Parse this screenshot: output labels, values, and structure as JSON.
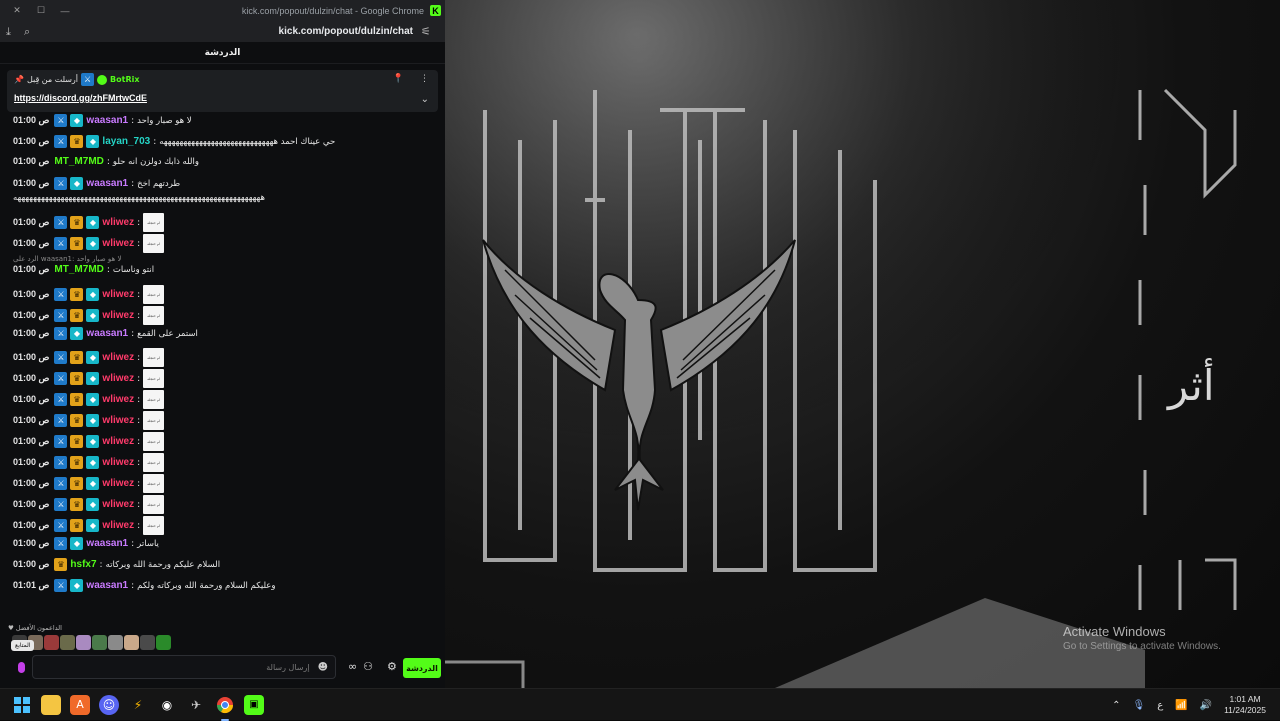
{
  "browser": {
    "window_title": "kick.com/popout/dulzin/chat - Google Chrome",
    "url": "kick.com/popout/dulzin/chat",
    "window_controls": [
      "✕",
      "☐",
      "—"
    ]
  },
  "chat": {
    "header_title": "الدردشة",
    "pinned": {
      "sent_by_label": "أرسلت من قِبل",
      "sender": "BotRix",
      "link": "https://discord.gg/zhFMrtwCdE"
    },
    "reply_hint": "الرد على waasan1: لا هو صبار واحد",
    "emote_label": "ام حنجله",
    "messages": [
      {
        "time": "01:00 ص",
        "user": "waasan1",
        "color": "#c97bff",
        "badges": [
          "blue",
          "cyan"
        ],
        "text": "لا هو صبار واحد"
      },
      {
        "time": "01:00 ص",
        "user": "layan_703",
        "color": "#25d4c6",
        "badges": [
          "blue",
          "gold",
          "cyan"
        ],
        "text": "حي عيناك احمد هههههههههههههههههههههههههههههه"
      },
      {
        "time": "01:00 ص",
        "user": "MT_M7MD",
        "color": "#53fc18",
        "badges": [],
        "text": "والله ذابك دولزن انه حلو"
      },
      {
        "time": "01:00 ص",
        "user": "waasan1",
        "color": "#c97bff",
        "badges": [
          "blue",
          "cyan"
        ],
        "text": "طردتهم اخخ"
      },
      {
        "time": "",
        "user": "",
        "color": "#eaeaea",
        "badges": [],
        "text": "هههههههههههههههههههههههههههههههههههههههههههههههههههههههههههههههه"
      },
      {
        "time": "01:00 ص",
        "user": "wliwez",
        "color": "#ff3b6b",
        "badges": [
          "blue",
          "gold",
          "cyan"
        ],
        "emote": true
      },
      {
        "time": "01:00 ص",
        "user": "wliwez",
        "color": "#ff3b6b",
        "badges": [
          "blue",
          "gold",
          "cyan"
        ],
        "emote": true
      },
      {
        "time": "01:00 ص",
        "user": "MT_M7MD",
        "color": "#53fc18",
        "badges": [],
        "text": "انتو وناسات"
      },
      {
        "time": "01:00 ص",
        "user": "wliwez",
        "color": "#ff3b6b",
        "badges": [
          "blue",
          "gold",
          "cyan"
        ],
        "emote": true
      },
      {
        "time": "01:00 ص",
        "user": "wliwez",
        "color": "#ff3b6b",
        "badges": [
          "blue",
          "gold",
          "cyan"
        ],
        "emote": true
      },
      {
        "time": "01:00 ص",
        "user": "waasan1",
        "color": "#c97bff",
        "badges": [
          "blue",
          "cyan"
        ],
        "text": "استمر على القمع"
      },
      {
        "time": "01:00 ص",
        "user": "wliwez",
        "color": "#ff3b6b",
        "badges": [
          "blue",
          "gold",
          "cyan"
        ],
        "emote": true
      },
      {
        "time": "01:00 ص",
        "user": "wliwez",
        "color": "#ff3b6b",
        "badges": [
          "blue",
          "gold",
          "cyan"
        ],
        "emote": true
      },
      {
        "time": "01:00 ص",
        "user": "wliwez",
        "color": "#ff3b6b",
        "badges": [
          "blue",
          "gold",
          "cyan"
        ],
        "emote": true
      },
      {
        "time": "01:00 ص",
        "user": "wliwez",
        "color": "#ff3b6b",
        "badges": [
          "blue",
          "gold",
          "cyan"
        ],
        "emote": true
      },
      {
        "time": "01:00 ص",
        "user": "wliwez",
        "color": "#ff3b6b",
        "badges": [
          "blue",
          "gold",
          "cyan"
        ],
        "emote": true
      },
      {
        "time": "01:00 ص",
        "user": "wliwez",
        "color": "#ff3b6b",
        "badges": [
          "blue",
          "gold",
          "cyan"
        ],
        "emote": true
      },
      {
        "time": "01:00 ص",
        "user": "wliwez",
        "color": "#ff3b6b",
        "badges": [
          "blue",
          "gold",
          "cyan"
        ],
        "emote": true
      },
      {
        "time": "01:00 ص",
        "user": "wliwez",
        "color": "#ff3b6b",
        "badges": [
          "blue",
          "gold",
          "cyan"
        ],
        "emote": true
      },
      {
        "time": "01:00 ص",
        "user": "wliwez",
        "color": "#ff3b6b",
        "badges": [
          "blue",
          "gold",
          "cyan"
        ],
        "emote": true
      },
      {
        "time": "01:00 ص",
        "user": "waasan1",
        "color": "#c97bff",
        "badges": [
          "blue",
          "cyan"
        ],
        "text": "ياساتر"
      },
      {
        "time": "01:00 ص",
        "user": "hsfx7",
        "color": "#53fc18",
        "badges": [
          "gold"
        ],
        "text": "السلام عليكم ورحمة الله وبركاته"
      },
      {
        "time": "01:01 ص",
        "user": "waasan1",
        "color": "#c97bff",
        "badges": [
          "blue",
          "cyan"
        ],
        "text": "وعليكم السلام ورحمة الله وبركاته ولكم"
      }
    ],
    "supporters_label": "الداعمون الأفضل",
    "tooltip": "المتابع",
    "input_placeholder": "إرسال رسالة",
    "send_label": "الدردشة"
  },
  "desktop": {
    "watermark_title": "Activate Windows",
    "watermark_sub": "Go to Settings to activate Windows.",
    "wallpaper_text": "أثر"
  },
  "taskbar": {
    "tray_lang": "ع",
    "time": "1:01 AM",
    "date": "11/24/2025"
  }
}
